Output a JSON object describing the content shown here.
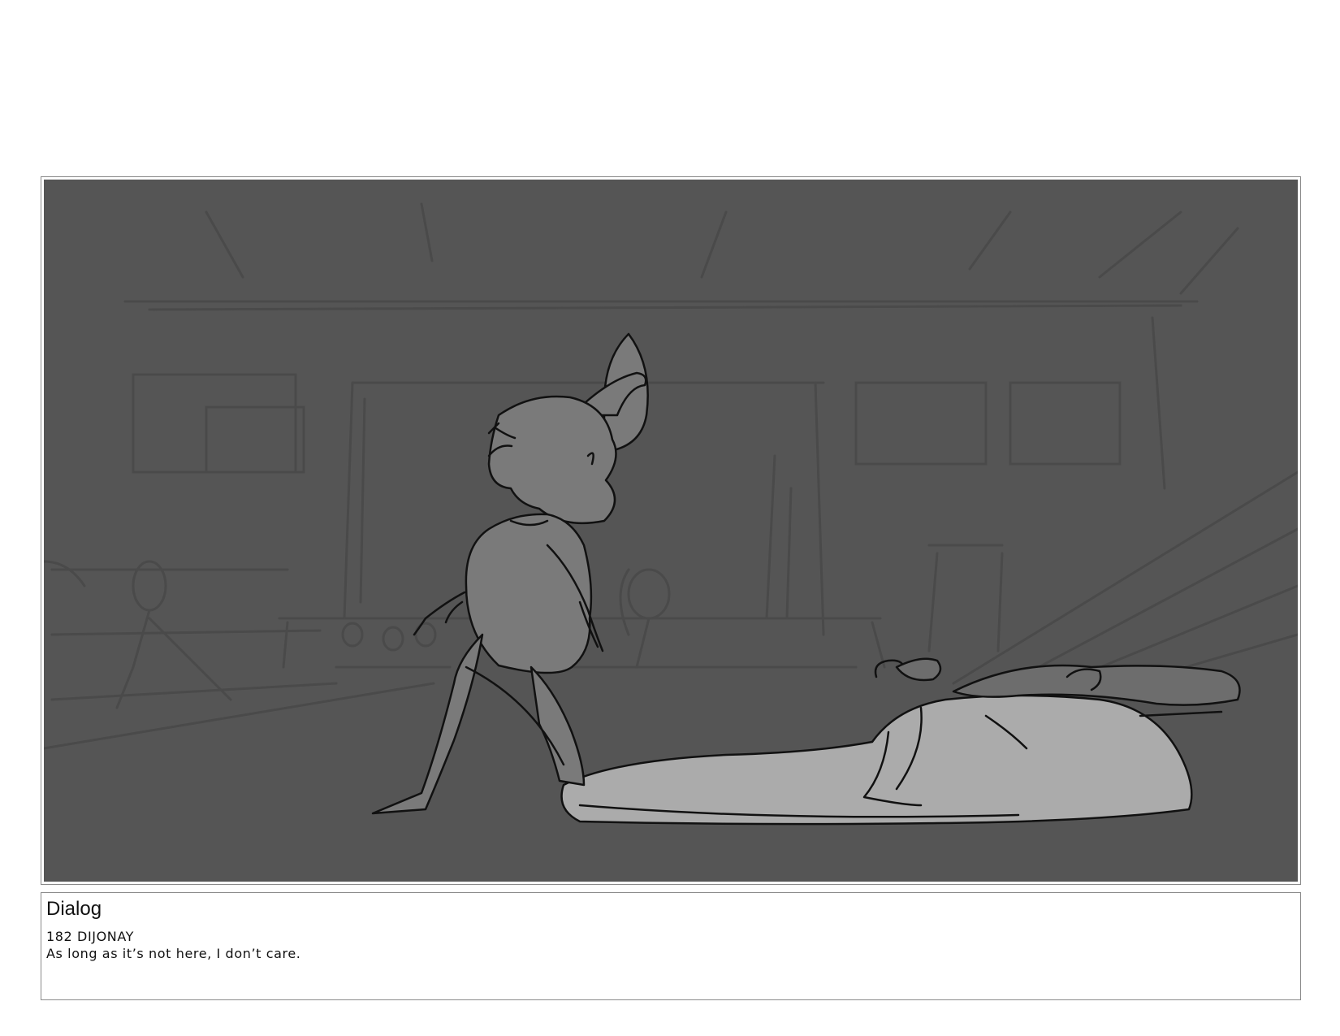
{
  "colors": {
    "panel_background": "#555555",
    "background_lines": "#4a4a4a",
    "character_fill": "#7a7a7a",
    "lying_figure_fill": "#ababab",
    "ink": "#111111",
    "frame_border": "#8a8a8a"
  },
  "dialog": {
    "heading": "Dialog",
    "speaker_line": "182 DIJONAY",
    "line": "As long as it’s not here, I don’t care."
  }
}
